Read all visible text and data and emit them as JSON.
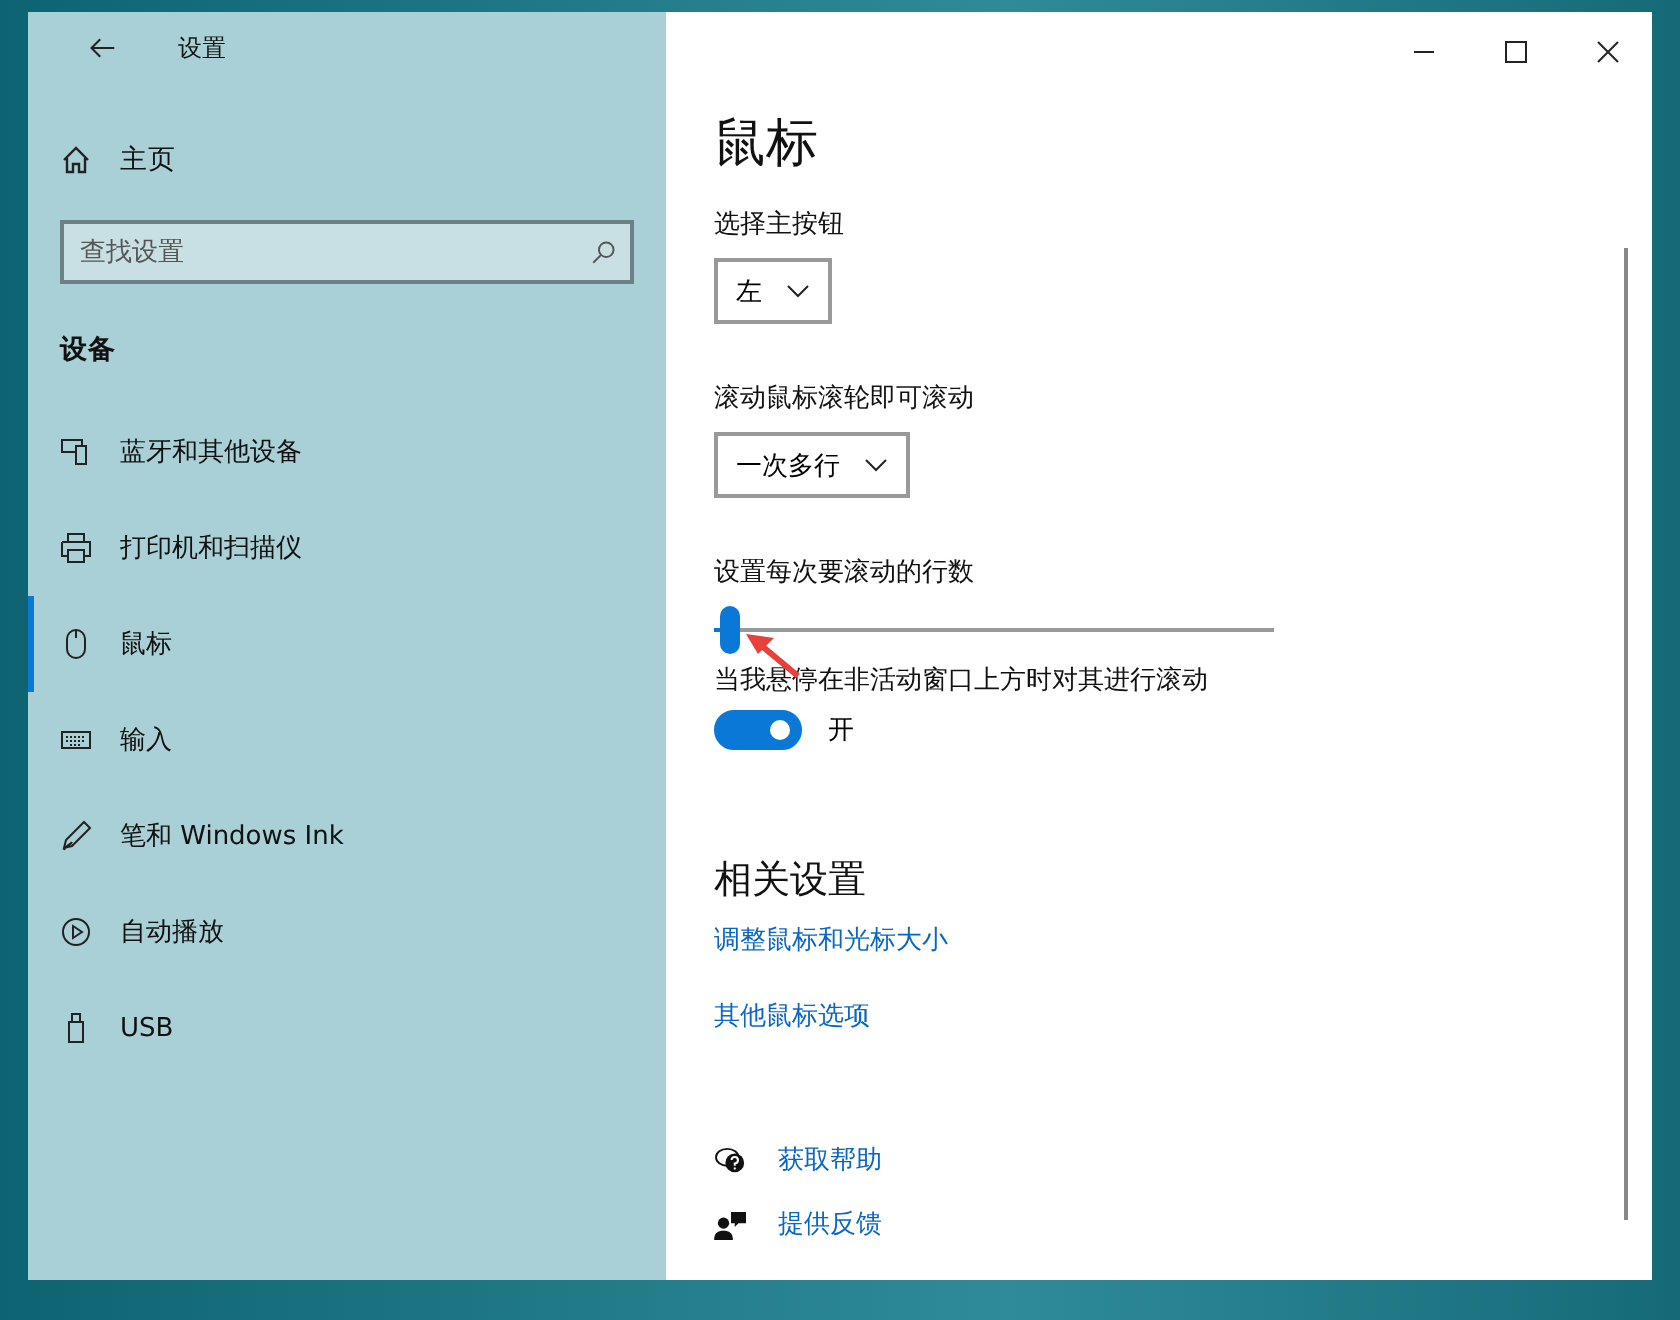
{
  "window": {
    "title": "设置"
  },
  "sidebar": {
    "home": "主页",
    "search": {
      "placeholder": "查找设置"
    },
    "section": "设备",
    "items": [
      {
        "label": "蓝牙和其他设备",
        "kind": "bluetooth",
        "selected": false
      },
      {
        "label": "打印机和扫描仪",
        "kind": "printer",
        "selected": false
      },
      {
        "label": "鼠标",
        "kind": "mouse",
        "selected": true
      },
      {
        "label": "输入",
        "kind": "keyboard",
        "selected": false
      },
      {
        "label": "笔和 Windows Ink",
        "kind": "pen",
        "selected": false
      },
      {
        "label": "自动播放",
        "kind": "autoplay",
        "selected": false
      },
      {
        "label": "USB",
        "kind": "usb",
        "selected": false
      }
    ]
  },
  "page": {
    "title": "鼠标",
    "primary_button": {
      "label": "选择主按钮",
      "value": "左"
    },
    "scroll_mode": {
      "label": "滚动鼠标滚轮即可滚动",
      "value": "一次多行"
    },
    "lines_slider": {
      "label": "设置每次要滚动的行数",
      "level": 0.03
    },
    "inactive_scroll": {
      "label": "当我悬停在非活动窗口上方时对其进行滚动",
      "on": true,
      "state": "开"
    },
    "related": {
      "title": "相关设置",
      "links": [
        "调整鼠标和光标大小",
        "其他鼠标选项"
      ]
    },
    "help": [
      {
        "label": "获取帮助",
        "kind": "help"
      },
      {
        "label": "提供反馈",
        "kind": "feedback"
      }
    ]
  }
}
